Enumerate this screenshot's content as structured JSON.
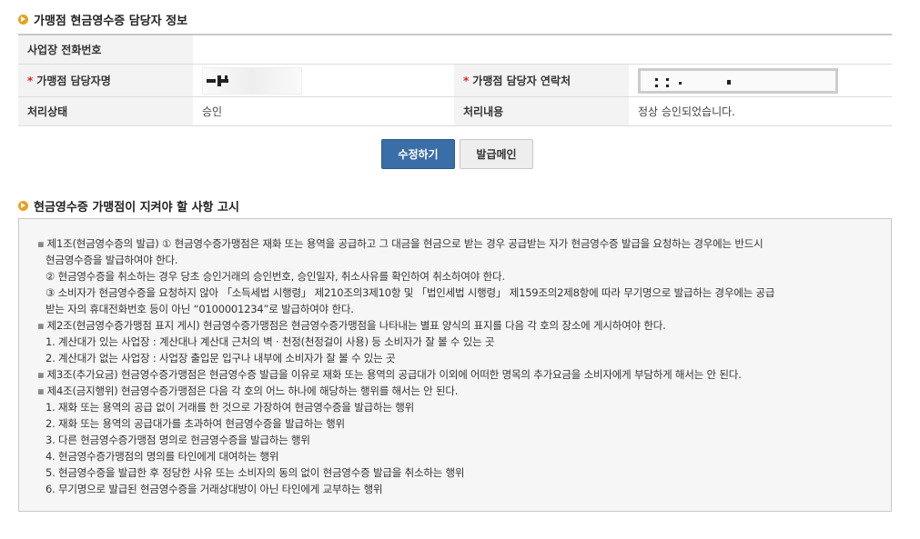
{
  "section1": {
    "title": "가맹점 현금영수증 담당자 정보"
  },
  "info_table": {
    "phone_label": "사업장 전화번호",
    "phone_value": "",
    "manager_label": "가맹점 담당자명",
    "contact_label": "가맹점 담당자 연락처",
    "status_label": "처리상태",
    "status_value": "승인",
    "content_label": "처리내용",
    "content_value": "정상 승인되었습니다.",
    "required_mark": "*"
  },
  "buttons": {
    "modify": "수정하기",
    "main": "발급메인"
  },
  "section2": {
    "title": "현금영수증 가맹점이 지켜야 할 사항 고시"
  },
  "notice": {
    "lines": [
      {
        "type": "art",
        "text": "제1조(현금영수증의 발급) ① 현금영수증가맹점은 재화 또는 용역을 공급하고 그 대금을 현금으로 받는 경우 공급받는 자가 현금영수증 발급을 요청하는 경우에는 반드시"
      },
      {
        "type": "sub",
        "text": "현금영수증을 발급하여야 한다."
      },
      {
        "type": "sub",
        "text": "② 현금영수증을 취소하는 경우 당초 승인거래의 승인번호, 승인일자, 취소사유를 확인하여 취소하여야 한다."
      },
      {
        "type": "sub",
        "text": "③ 소비자가 현금영수증을 요청하지 않아 「소득세법 시행령」 제210조의3제10항 및 「법인세법 시행령」 제159조의2제8항에 따라 무기명으로 발급하는 경우에는 공급"
      },
      {
        "type": "sub",
        "text": "받는 자의 휴대전화번호 등이 아닌 “0100001234”로 발급하여야 한다."
      },
      {
        "type": "art",
        "text": "제2조(현금영수증가맹점 표지 게시) 현금영수증가맹점은 현금영수증가맹점을 나타내는 별표 양식의 표지를 다음 각 호의 장소에 게시하여야 한다."
      },
      {
        "type": "sub",
        "text": "1. 계산대가 있는 사업장 : 계산대나 계산대 근처의 벽 · 천정(천정걸이 사용) 등 소비자가 잘 볼 수 있는 곳"
      },
      {
        "type": "sub",
        "text": "2. 계산대가 없는 사업장 : 사업장 출입문 입구나 내부에 소비자가 잘 볼 수 있는 곳"
      },
      {
        "type": "art",
        "text": "제3조(추가요금) 현금영수증가맹점은 현금영수증 발급을 이유로 재화 또는 용역의 공급대가 이외에 어떠한 명목의 추가요금을 소비자에게 부담하게 해서는 안 된다."
      },
      {
        "type": "art",
        "text": "제4조(금지행위) 현금영수증가맹점은 다음 각 호의 어느 하나에 해당하는 행위를 해서는 안 된다."
      },
      {
        "type": "sub",
        "text": "1. 재화 또는 용역의 공급 없이 거래를 한 것으로 가장하여 현금영수증을 발급하는 행위"
      },
      {
        "type": "sub",
        "text": "2. 재화 또는 용역의 공급대가를 초과하여 현금영수증을 발급하는 행위"
      },
      {
        "type": "sub",
        "text": "3. 다른 현금영수증가맹점 명의로 현금영수증을 발급하는 행위"
      },
      {
        "type": "sub",
        "text": "4. 현금영수증가맹점의 명의를 타인에게 대여하는 행위"
      },
      {
        "type": "sub",
        "text": "5. 현금영수증을 발급한 후 정당한 사유 또는 소비자의 동의 없이 현금영수증 발급을 취소하는 행위"
      },
      {
        "type": "sub",
        "text": "6. 무기명으로 발급된 현금영수증을 거래상대방이 아닌 타인에게 교부하는 행위"
      }
    ]
  },
  "icons": {
    "section_bullet": "circle-arrow-icon",
    "article_bullet": "square-bullet-icon"
  },
  "colors": {
    "accent": "#e8a020",
    "primary_button": "#3a6ea8",
    "required": "#dd2222"
  }
}
